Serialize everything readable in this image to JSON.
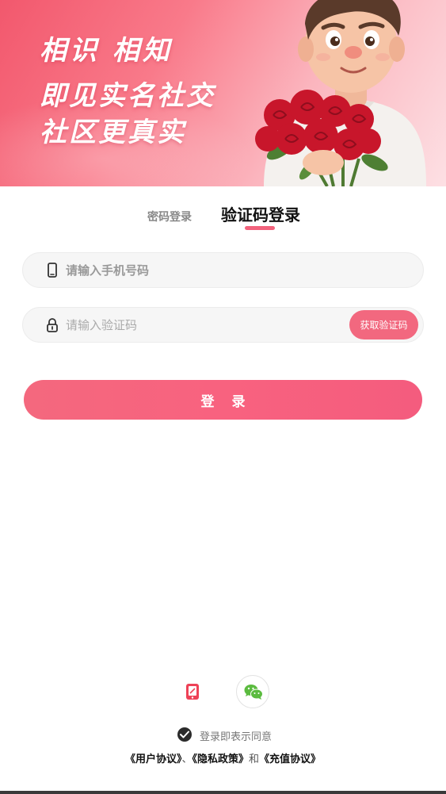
{
  "banner": {
    "slogan_line1": "相识 相知",
    "slogan_line2": "即见实名社交",
    "slogan_line3": "社区更真实"
  },
  "tabs": {
    "password_login": "密码登录",
    "code_login": "验证码登录",
    "active": "code_login"
  },
  "form": {
    "phone_placeholder": "请输入手机号码",
    "phone_value": "",
    "code_placeholder": "请输入验证码",
    "code_value": "",
    "get_code_label": "获取验证码",
    "login_label": "登录"
  },
  "alt_login": {
    "phone_icon": "phone-icon",
    "wechat_icon": "wechat-icon"
  },
  "agreement": {
    "checked": true,
    "prefix": "登录即表示同意",
    "user_agreement": "《用户协议》",
    "sep1": "、",
    "privacy_policy": "《隐私政策》",
    "and": "和",
    "recharge_agreement": "《充值协议》"
  },
  "colors": {
    "accent": "#f2627c",
    "banner_start": "#f2586d",
    "banner_end": "#fde0e4"
  }
}
